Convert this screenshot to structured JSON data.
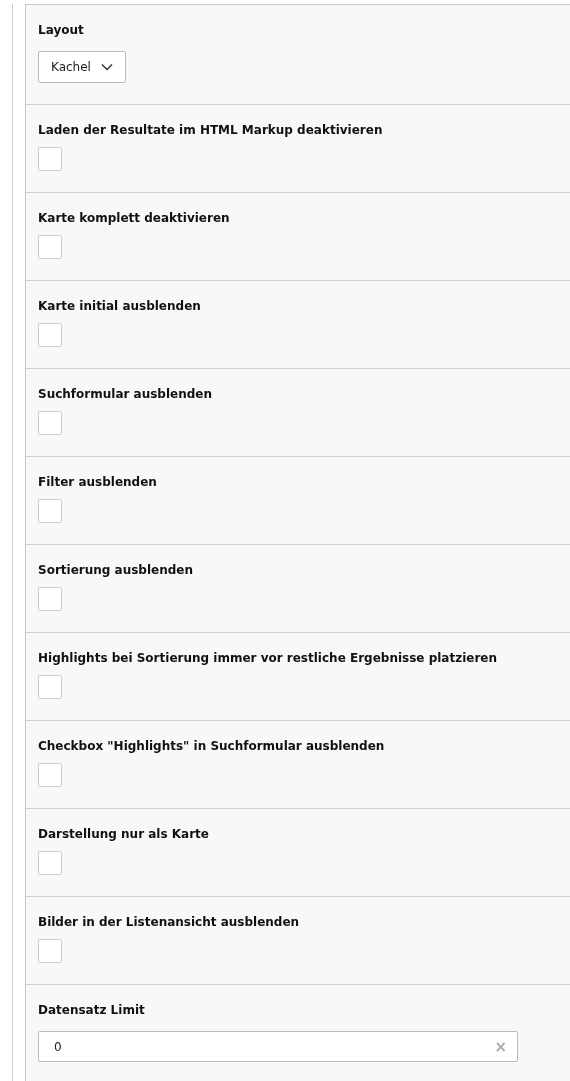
{
  "fields": [
    {
      "kind": "select",
      "label": "Layout",
      "value": "Kachel"
    },
    {
      "kind": "checkbox",
      "label": "Laden der Resultate im HTML Markup deaktivieren",
      "checked": false
    },
    {
      "kind": "checkbox",
      "label": "Karte komplett deaktivieren",
      "checked": false
    },
    {
      "kind": "checkbox",
      "label": "Karte initial ausblenden",
      "checked": false
    },
    {
      "kind": "checkbox",
      "label": "Suchformular ausblenden",
      "checked": false
    },
    {
      "kind": "checkbox",
      "label": "Filter ausblenden",
      "checked": false
    },
    {
      "kind": "checkbox",
      "label": "Sortierung ausblenden",
      "checked": false
    },
    {
      "kind": "checkbox",
      "label": "Highlights bei Sortierung immer vor restliche Ergebnisse platzieren",
      "checked": false
    },
    {
      "kind": "checkbox",
      "label": "Checkbox \"Highlights\" in Suchformular ausblenden",
      "checked": false
    },
    {
      "kind": "checkbox",
      "label": "Darstellung nur als Karte",
      "checked": false
    },
    {
      "kind": "checkbox",
      "label": "Bilder in der Listenansicht ausblenden",
      "checked": false
    },
    {
      "kind": "text",
      "label": "Datensatz Limit",
      "value": "0",
      "clear": "×"
    }
  ]
}
